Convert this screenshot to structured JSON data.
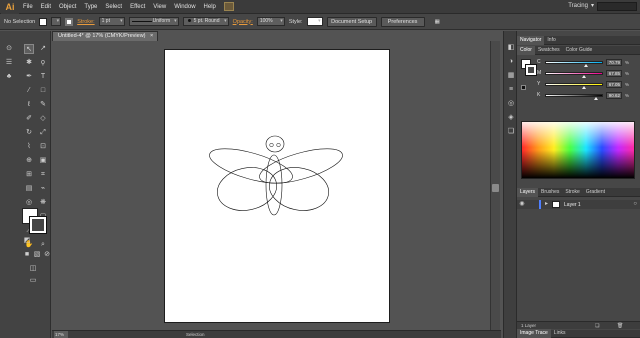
{
  "app": {
    "logo": "Ai"
  },
  "menu": [
    "File",
    "Edit",
    "Object",
    "Type",
    "Select",
    "Effect",
    "View",
    "Window",
    "Help"
  ],
  "workspace": {
    "label": "Tracing",
    "chevron": "▾"
  },
  "control_bar": {
    "selection_status": "No Selection",
    "stroke_label": "Stroke:",
    "stroke_weight": "1 pt",
    "stroke_profile": "Uniform",
    "brush": "5 pt. Round",
    "opacity_label": "Opacity:",
    "opacity_value": "100%",
    "style_label": "Style:",
    "document_setup": "Document Setup",
    "preferences": "Preferences"
  },
  "document": {
    "tab_title": "Untitled-4* @ 17% (CMYK/Preview)",
    "close_glyph": "×"
  },
  "status": {
    "zoom": "17%",
    "tool": "Selection"
  },
  "color_panel": {
    "tabs": [
      "Navigator",
      "Info"
    ],
    "tabs2": [
      "Color",
      "Swatches",
      "Color Guide"
    ],
    "channels": [
      {
        "label": "C",
        "value": "70.79",
        "fraction": 0.72,
        "color_from": "#ffffff",
        "color_to": "#00aeef"
      },
      {
        "label": "M",
        "value": "67.85",
        "fraction": 0.68,
        "color_from": "#ffffff",
        "color_to": "#ec008c"
      },
      {
        "label": "Y",
        "value": "67.05",
        "fraction": 0.67,
        "color_from": "#ffffff",
        "color_to": "#fff200"
      },
      {
        "label": "K",
        "value": "90.62",
        "fraction": 0.9,
        "color_from": "#ffffff",
        "color_to": "#000000"
      }
    ],
    "percent_sign": "%"
  },
  "layers_panel": {
    "tabs": [
      "Layers",
      "Brushes",
      "Stroke",
      "Gradient"
    ],
    "layers": [
      {
        "name": "Layer 1",
        "color": "#4f7fff"
      }
    ],
    "footer_count": "1 Layer"
  },
  "bottom_tabs": [
    "Image Trace",
    "Links"
  ],
  "colors": {
    "accent_orange": "#e89a3c",
    "layer_blue": "#4f7fff",
    "artboard": "#ffffff"
  }
}
